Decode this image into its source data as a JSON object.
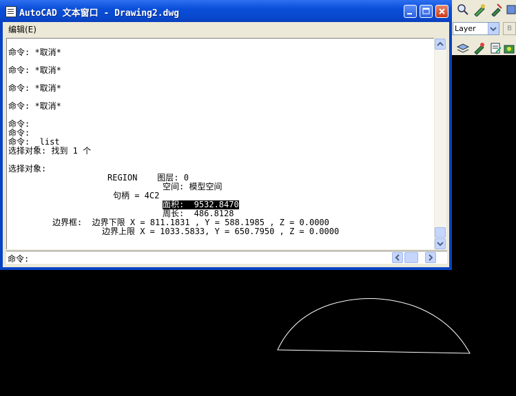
{
  "window": {
    "title": "AutoCAD 文本窗口 - Drawing2.dwg"
  },
  "menu": {
    "edit": "编辑(E)"
  },
  "history": {
    "lines": [
      "命令: *取消*",
      "命令: *取消*",
      "命令: *取消*",
      "命令: *取消*",
      "命令:",
      "命令:",
      "命令: _list",
      "选择对象: 找到 1 个",
      "选择对象:",
      "REGION    图层: 0",
      "空间: 模型空间",
      "句柄 = 4C2",
      "面积:  9532.8470",
      "周长:  486.8128",
      "边界框:  边界下限 X = 811.1831 , Y = 588.1985 , Z = 0.0000",
      "边界上限 X = 1033.5833, Y = 650.7950 , Z = 0.0000"
    ]
  },
  "command_line": {
    "prompt": "命令:"
  },
  "toolbar": {
    "layer_combo": "Layer"
  },
  "colors": {
    "title_bar": "#0a4fd9",
    "selection": "#000000",
    "drawing_bg": "#000000",
    "drawing_stroke": "#ffffff"
  }
}
